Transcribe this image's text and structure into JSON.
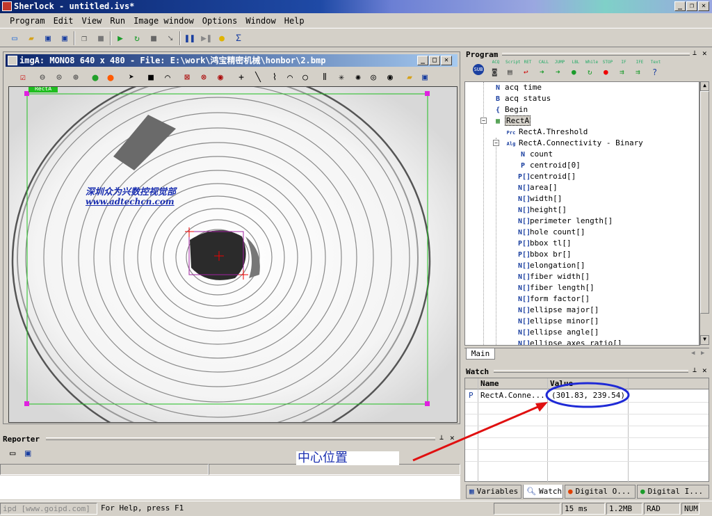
{
  "app_title": "Sherlock - untitled.ivs*",
  "menu": [
    "Program",
    "Edit",
    "View",
    "Run",
    "Image window",
    "Options",
    "Window",
    "Help"
  ],
  "image_window": {
    "title": "imgA: MONO8 640 x 480 - File: E:\\work\\鸿宝精密机械\\honbor\\2.bmp",
    "roi_tag": "RectA",
    "watermark_line1": "深圳众为兴数控视觉部",
    "watermark_line2": "www.adtechcn.com"
  },
  "program_panel": {
    "title": "Program",
    "toolbar_labels": [
      "ACQ",
      "Script",
      "RET",
      "CALL",
      "JUMP",
      "LBL",
      "While",
      "STOP",
      "IF",
      "IFE",
      "Text"
    ],
    "tree": [
      {
        "icon": "N",
        "label": "acq time",
        "indent": 1
      },
      {
        "icon": "B",
        "label": "acq status",
        "indent": 1
      },
      {
        "icon": "{",
        "label": "Begin",
        "indent": 1
      },
      {
        "icon": "▦",
        "label": "RectA",
        "indent": 1
      },
      {
        "icon": "Prc",
        "label": "RectA.Threshold",
        "indent": 2
      },
      {
        "icon": "Alg",
        "label": "RectA.Connectivity - Binary",
        "indent": 2
      },
      {
        "icon": "N",
        "label": "count",
        "indent": 3
      },
      {
        "icon": "P",
        "label": "centroid[0]",
        "indent": 3
      },
      {
        "icon": "P[]",
        "label": "centroid[]",
        "indent": 3
      },
      {
        "icon": "N[]",
        "label": "area[]",
        "indent": 3
      },
      {
        "icon": "N[]",
        "label": "width[]",
        "indent": 3
      },
      {
        "icon": "N[]",
        "label": "height[]",
        "indent": 3
      },
      {
        "icon": "N[]",
        "label": "perimeter length[]",
        "indent": 3
      },
      {
        "icon": "N[]",
        "label": "hole count[]",
        "indent": 3
      },
      {
        "icon": "P[]",
        "label": "bbox tl[]",
        "indent": 3
      },
      {
        "icon": "P[]",
        "label": "bbox br[]",
        "indent": 3
      },
      {
        "icon": "N[]",
        "label": "elongation[]",
        "indent": 3
      },
      {
        "icon": "N[]",
        "label": "fiber width[]",
        "indent": 3
      },
      {
        "icon": "N[]",
        "label": "fiber length[]",
        "indent": 3
      },
      {
        "icon": "N[]",
        "label": "form factor[]",
        "indent": 3
      },
      {
        "icon": "N[]",
        "label": "ellipse major[]",
        "indent": 3
      },
      {
        "icon": "N[]",
        "label": "ellipse minor[]",
        "indent": 3
      },
      {
        "icon": "N[]",
        "label": "ellipse angle[]",
        "indent": 3
      },
      {
        "icon": "N[]",
        "label": "ellipse axes ratio[]",
        "indent": 3
      }
    ],
    "tab": "Main"
  },
  "watch_panel": {
    "title": "Watch",
    "col_name": "Name",
    "col_value": "Value",
    "rows": [
      {
        "type": "P",
        "name": "RectA.Conne...",
        "value": "(301.83, 239.54)"
      }
    ]
  },
  "annotation": {
    "text": "中心位置",
    "circle_color": "#1f2ad6",
    "arrow_color": "#e01010"
  },
  "reporter_panel": {
    "title": "Reporter"
  },
  "bottom_tabs": [
    "Variables",
    "Watch",
    "Digital O...",
    "Digital I..."
  ],
  "status": {
    "left": "ipd [www.goipd.com]",
    "help": "For Help, press F1",
    "time": "15 ms",
    "mem": "1.2MB",
    "angle": "RAD",
    "num": "NUM"
  }
}
